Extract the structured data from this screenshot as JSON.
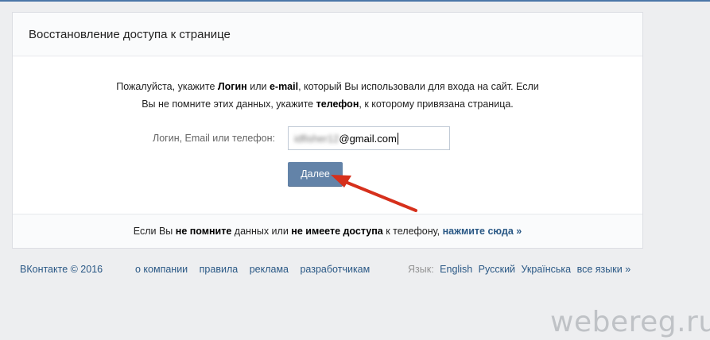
{
  "card": {
    "title": "Восстановление доступа к странице",
    "intro": {
      "p1": "Пожалуйста, укажите ",
      "b1": "Логин",
      "p2": " или ",
      "b2": "e-mail",
      "p3": ", который Вы использовали для входа на сайт. Если",
      "p4": "Вы не помните этих данных, укажите ",
      "b3": "телефон",
      "p5": ", к которому привязана страница."
    },
    "field_label": "Логин, Email или телефон:",
    "field_value_hidden": "idfisher12",
    "field_value_visible": "@gmail.com",
    "submit_label": "Далее",
    "footer": {
      "p1": "Если Вы ",
      "b1": "не помните",
      "p2": " данных или ",
      "b2": "не имеете доступа",
      "p3": " к телефону, ",
      "link": "нажмите сюда »"
    }
  },
  "footer": {
    "copyright": "ВКонтакте © 2016",
    "links": [
      "о компании",
      "правила",
      "реклама",
      "разработчикам"
    ],
    "lang_label": "Язык:",
    "languages": [
      "English",
      "Русский",
      "Українська",
      "все языки »"
    ]
  },
  "watermark": "webereg.ru",
  "colors": {
    "accent": "#6383a8",
    "link": "#2a5885",
    "arrow": "#d6301c"
  }
}
